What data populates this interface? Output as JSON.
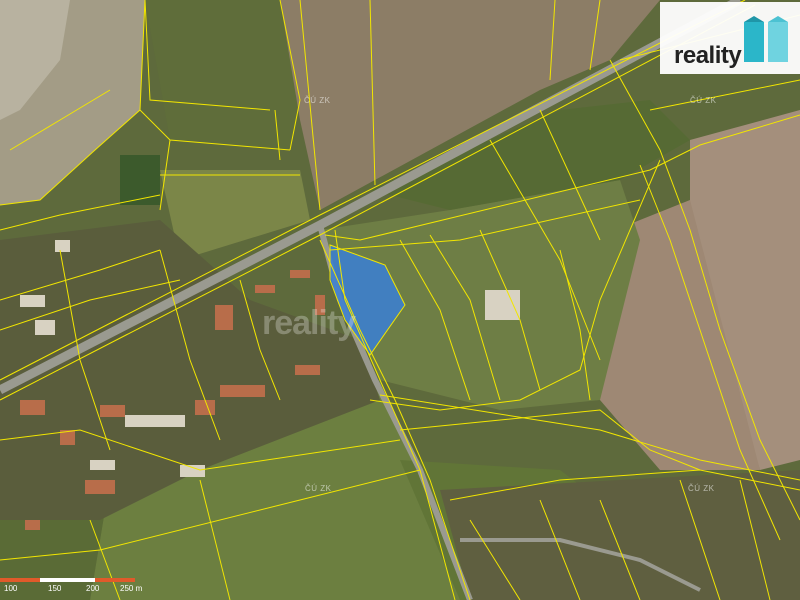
{
  "brand": {
    "name": "reality",
    "accent": "#2bb6c9"
  },
  "watermark": "reality",
  "cadastre_labels": [
    "ČÚ ZK",
    "ČÚ ZK",
    "ČÚ ZK",
    "ČÚ ZK"
  ],
  "scale_bar": {
    "ticks": [
      "100",
      "150",
      "200",
      "250 m"
    ]
  },
  "colors": {
    "parcel_lines": "#f2e600",
    "highlighted_parcel": "#3a7fd6",
    "road": "#9a9a90",
    "field": "#7a8a4a",
    "soil": "#8a7a62"
  }
}
